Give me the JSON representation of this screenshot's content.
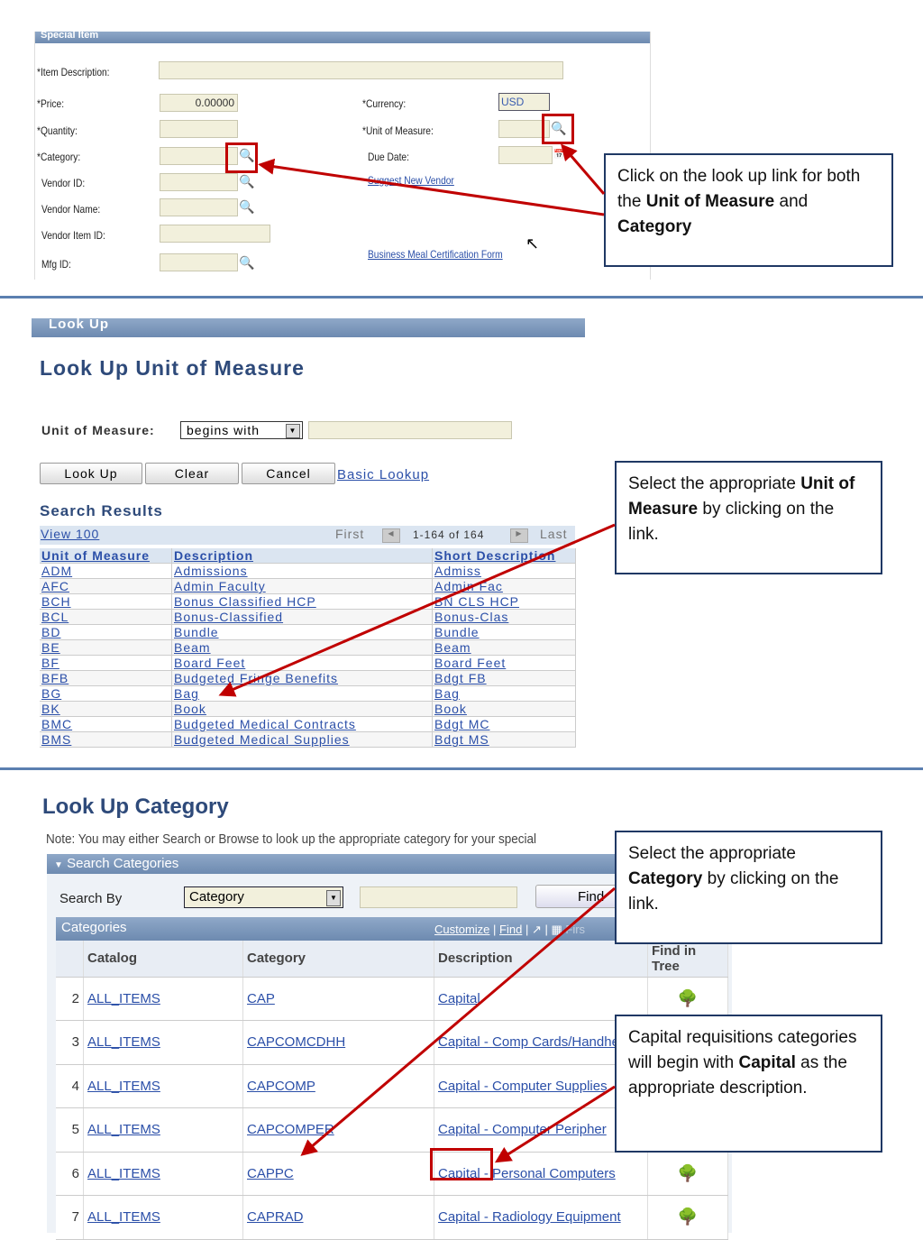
{
  "panel1": {
    "header": "Special Item",
    "item_description": "*Item Description:",
    "price": "*Price:",
    "price_value": "0.00000",
    "quantity": "*Quantity:",
    "category": "*Category:",
    "vendor_id": "Vendor ID:",
    "vendor_name": "Vendor Name:",
    "vendor_item_id": "Vendor Item ID:",
    "mfg_id": "Mfg ID:",
    "currency": "*Currency:",
    "currency_value": "USD",
    "unit_of_measure": "*Unit of Measure:",
    "due_date": "Due Date:",
    "suggest_vendor": "Suggest New Vendor",
    "business_meal": "Business Meal Certification Form"
  },
  "callout1": {
    "pre": "Click on the look up link for both the ",
    "b1": "Unit of Measure",
    "mid": " and ",
    "b2": "Category"
  },
  "panel2": {
    "header": "Look Up",
    "title": "Look Up Unit of Measure",
    "field_label": "Unit of Measure:",
    "operator": "begins with",
    "buttons": {
      "lookup": "Look Up",
      "clear": "Clear",
      "cancel": "Cancel"
    },
    "basic_lookup": "Basic Lookup",
    "results_title": "Search Results",
    "view_all": "View 100",
    "first": "First",
    "range": "1-164 of 164",
    "last": "Last",
    "columns": [
      "Unit of Measure",
      "Description",
      "Short Description"
    ],
    "rows": [
      [
        "ADM",
        "Admissions",
        "Admiss"
      ],
      [
        "AFC",
        "Admin Faculty",
        "Admin Fac"
      ],
      [
        "BCH",
        "Bonus Classified HCP",
        "BN CLS HCP"
      ],
      [
        "BCL",
        "Bonus-Classified",
        "Bonus-Clas"
      ],
      [
        "BD",
        "Bundle",
        "Bundle"
      ],
      [
        "BE",
        "Beam",
        "Beam"
      ],
      [
        "BF",
        "Board Feet",
        "Board Feet"
      ],
      [
        "BFB",
        "Budgeted Fringe Benefits",
        "Bdgt FB"
      ],
      [
        "BG",
        "Bag",
        "Bag"
      ],
      [
        "BK",
        "Book",
        "Book"
      ],
      [
        "BMC",
        "Budgeted Medical Contracts",
        "Bdgt MC"
      ],
      [
        "BMS",
        "Budgeted Medical Supplies",
        "Bdgt MS"
      ]
    ]
  },
  "callout2": {
    "pre": "Select the appropriate ",
    "b1": "Unit of Measure",
    "post": " by clicking on the link."
  },
  "panel3": {
    "title": "Look Up Category",
    "note": "Note: You may either Search or Browse to look up the appropriate category for your special",
    "search_header": "Search Categories",
    "search_by": "Search By",
    "search_by_value": "Category",
    "find_button": "Find",
    "grid_title": "Categories",
    "customize": "Customize",
    "find": "Find",
    "first": "Firs",
    "columns": [
      "Catalog",
      "Category",
      "Description",
      "Find in Tree"
    ],
    "rows": [
      [
        "2",
        "ALL_ITEMS",
        "CAP",
        "Capital"
      ],
      [
        "3",
        "ALL_ITEMS",
        "CAPCOMCDHH",
        "Capital - Comp Cards/Handhelds"
      ],
      [
        "4",
        "ALL_ITEMS",
        "CAPCOMP",
        "Capital - Computer Supplies"
      ],
      [
        "5",
        "ALL_ITEMS",
        "CAPCOMPER",
        "Capital - Computer Peripher"
      ],
      [
        "6",
        "ALL_ITEMS",
        "CAPPC",
        "Capital - Personal Computers"
      ],
      [
        "7",
        "ALL_ITEMS",
        "CAPRAD",
        "Capital - Radiology Equipment"
      ]
    ]
  },
  "callout3": {
    "pre": "Select the appropriate ",
    "b1": "Category",
    "post": " by clicking on the link."
  },
  "callout4": {
    "pre": "Capital requisitions categories will begin with ",
    "b1": "Capital",
    "post": " as the appropriate description."
  },
  "colors": {
    "annotation_red": "#c00000",
    "link_blue": "#2b4fa8",
    "callout_border": "#1f3864"
  }
}
